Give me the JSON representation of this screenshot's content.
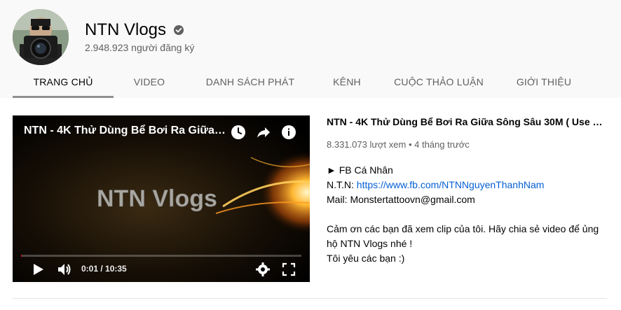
{
  "channel": {
    "name": "NTN Vlogs",
    "subscribers": "2.948.923 người đăng ký",
    "verified_icon": "verified-check-icon",
    "avatar_icon": "avatar-camera-photo"
  },
  "tabs": [
    {
      "label": "TRANG CHỦ",
      "active": true
    },
    {
      "label": "VIDEO"
    },
    {
      "label": "DANH SÁCH PHÁT"
    },
    {
      "label": "KÊNH"
    },
    {
      "label": "CUỘC THẢO LUẬN"
    },
    {
      "label": "GIỚI THIỆU"
    }
  ],
  "player": {
    "title": "NTN - 4K Thử Dùng Bể Bơi Ra Giữa Sông Sâu 30M ( Use Pool ...",
    "thumbnail_text": "NTN Vlogs",
    "time": "0:01 / 10:35",
    "progress_fraction": 0.0016,
    "icons": [
      "watch-later-icon",
      "share-icon",
      "info-icon",
      "play-icon",
      "volume-icon",
      "settings-icon",
      "fullscreen-icon"
    ]
  },
  "video": {
    "title": "NTN - 4K Thử Dùng Bể Bơi Ra Giữa Sông Sâu 30M ( Use Pool ...",
    "meta": "8.331.073 lượt xem • 4 tháng trước",
    "description": {
      "line1": "► FB Cá Nhân",
      "line2_prefix": "N.T.N: ",
      "line2_link": "https://www.fb.com/NTNNguyenThanhNam",
      "line3": "Mail: Monstertattoovn@gmail.com",
      "line4": "Cảm ơn các bạn đã xem clip của tôi. Hãy chia sẻ video để ủng",
      "line5": "hộ NTN Vlogs nhé !",
      "line6": "Tôi yêu các bạn :)"
    }
  },
  "colors": {
    "link": "#065fd4",
    "header_bg": "#f9f9f9",
    "progress": "#ff0000"
  }
}
